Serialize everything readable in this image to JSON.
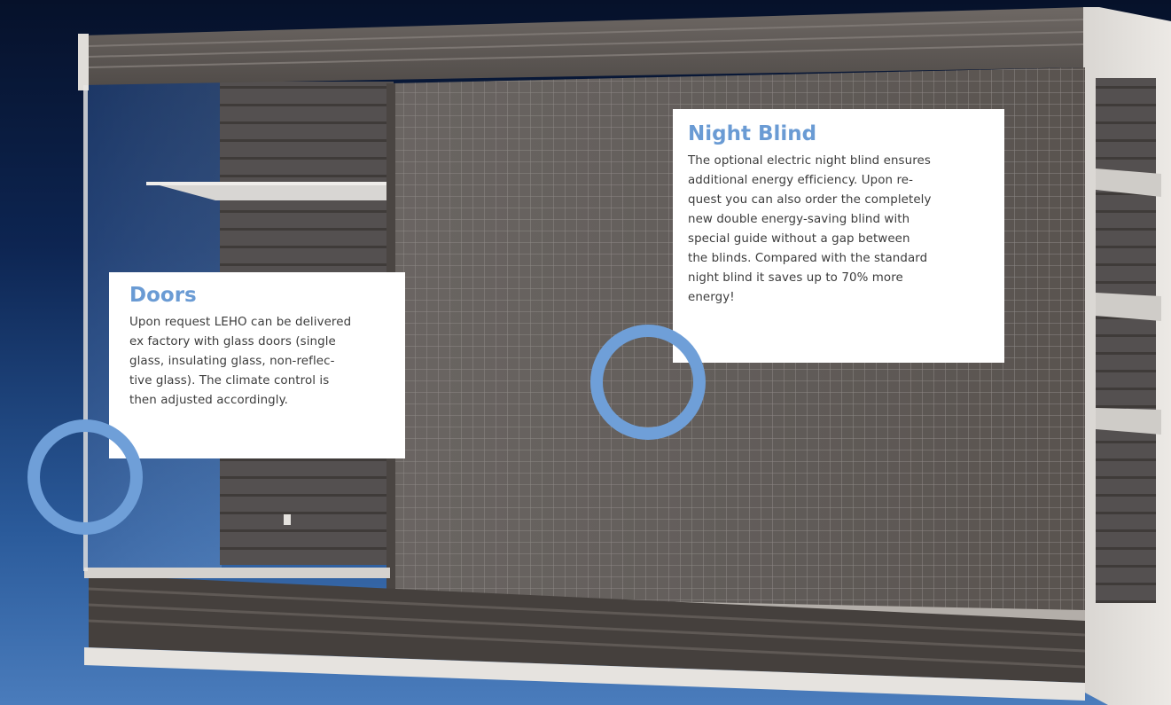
{
  "callouts": {
    "doors": {
      "title": "Doors",
      "lines": [
        "Upon request LEHO can be delivered",
        "ex factory with glass doors (single",
        "glass, insulating glass, non-reflec-",
        "tive glass). The climate control is",
        "then adjusted accordingly."
      ]
    },
    "night_blind": {
      "title": "Night Blind",
      "lines": [
        "The optional electric night blind ensures",
        "additional energy efficiency. Upon re-",
        "quest you can also order the completely",
        "new double energy-saving blind with",
        "special guide without a gap between",
        "the blinds. Compared with the standard",
        "night blind it saves up to 70% more",
        "energy!"
      ]
    }
  },
  "colors": {
    "accent": "#6f9fd8",
    "heading": "#6a9bd4",
    "body_text": "#3b3b3b",
    "callout_bg": "#ffffff"
  }
}
